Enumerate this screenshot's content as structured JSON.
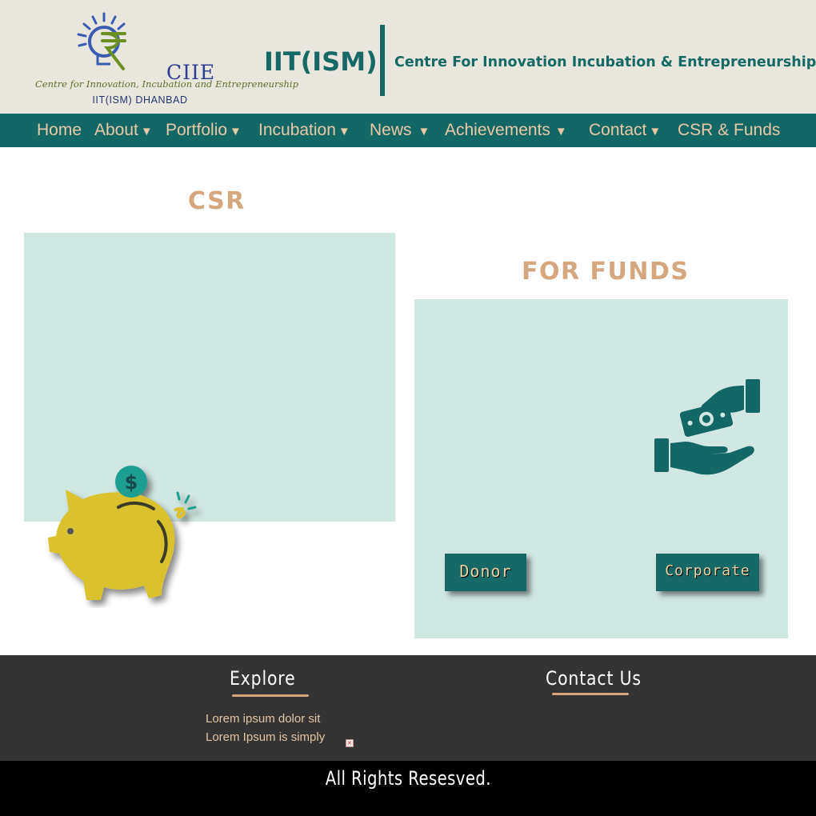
{
  "header": {
    "logo": {
      "wordmark": "CIIE",
      "tagline": "Centre for Innovation, Incubation and Entrepreneurship",
      "sub": "IIT(ISM) DHANBAD"
    },
    "org_name": "IIT(ISM)",
    "org_full": "Centre For Innovation Incubation & Entrepreneurship"
  },
  "nav": {
    "items": [
      {
        "label": "Home",
        "caret": ""
      },
      {
        "label": "About",
        "caret": "▼"
      },
      {
        "label": "Portfolio",
        "caret": "▼"
      },
      {
        "label": "Incubation",
        "caret": "▼"
      },
      {
        "label": "News",
        "caret": "▼"
      },
      {
        "label": "Achievements",
        "caret": "▼"
      },
      {
        "label": "Contact",
        "caret": "▼"
      },
      {
        "label": "CSR & Funds",
        "caret": ""
      }
    ]
  },
  "csr": {
    "title": "CSR",
    "image_icon": "piggy-bank-icon"
  },
  "funds": {
    "title": "FOR FUNDS",
    "image_icon": "money-exchange-icon",
    "donor_label": "Donor",
    "corporate_label": "Corporate"
  },
  "footer": {
    "explore": {
      "heading": "Explore",
      "links": [
        "Lorem ipsum dolor sit",
        "Lorem Ipsum is simply"
      ]
    },
    "contact": {
      "heading": "Contact Us"
    },
    "rights": "All Rights Resesved."
  },
  "colors": {
    "teal": "#176965",
    "nav_bg": "#136866",
    "header_bg": "#e9e7dd",
    "panel_bg": "#d1e7e2",
    "title_tan": "#d6a67e",
    "footer_bg": "#343434",
    "piggy_yellow": "#dbc12e"
  }
}
